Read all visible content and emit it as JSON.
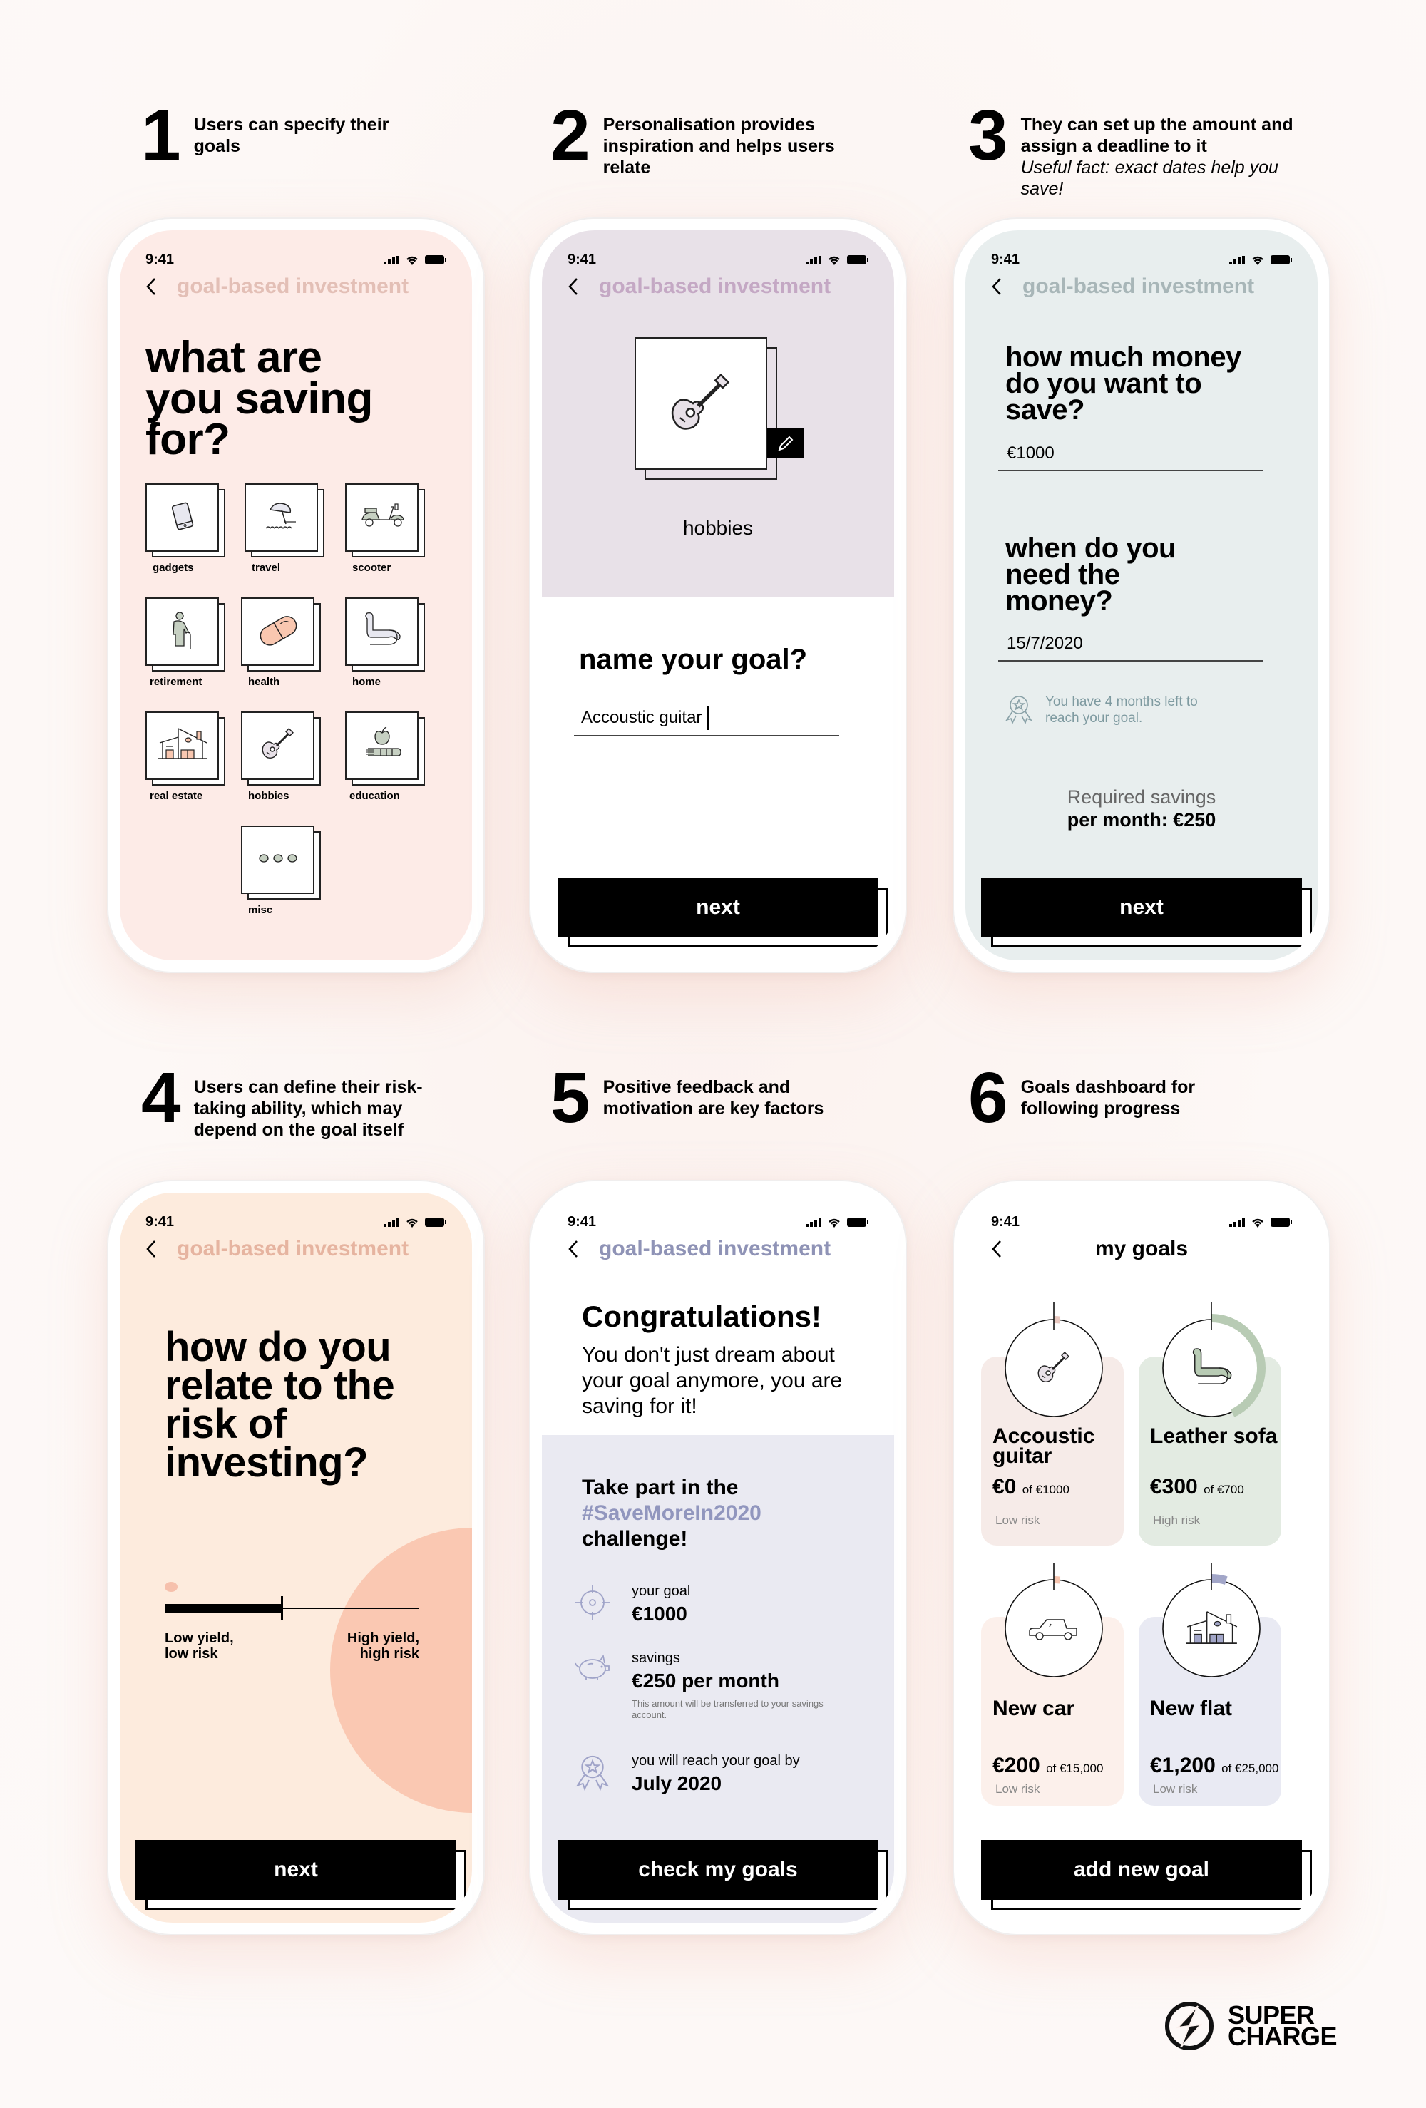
{
  "steps": [
    {
      "num": "1",
      "text": "Users can specify their goals"
    },
    {
      "num": "2",
      "text": "Personalisation provides inspiration and helps users relate"
    },
    {
      "num": "3",
      "text": "They can set up the amount and assign a deadline to it",
      "note": "Useful fact: exact dates help you save!"
    },
    {
      "num": "4",
      "text": "Users can define their risk-taking ability, which may depend on the goal itself"
    },
    {
      "num": "5",
      "text": "Positive feedback and motivation are key factors"
    },
    {
      "num": "6",
      "text": "Goals dashboard for following progress"
    }
  ],
  "status_time": "9:41",
  "nav_title": "goal-based investment",
  "screen1": {
    "question": "what are you saving for?",
    "categories": [
      {
        "label": "gadgets",
        "icon": "tablet-icon"
      },
      {
        "label": "travel",
        "icon": "beach-umbrella-icon"
      },
      {
        "label": "scooter",
        "icon": "scooter-icon"
      },
      {
        "label": "retirement",
        "icon": "elderly-person-icon"
      },
      {
        "label": "health",
        "icon": "pill-icon"
      },
      {
        "label": "home",
        "icon": "rocking-chair-icon"
      },
      {
        "label": "real estate",
        "icon": "house-icon"
      },
      {
        "label": "hobbies",
        "icon": "guitar-icon"
      },
      {
        "label": "education",
        "icon": "apple-book-icon"
      },
      {
        "label": "misc",
        "icon": "more-dots-icon"
      }
    ]
  },
  "screen2": {
    "category_label": "hobbies",
    "question": "name your goal?",
    "goal_name_value": "Accoustic guitar",
    "next_label": "next"
  },
  "screen3": {
    "q_amount": "how much money do you want to save?",
    "amount_value": "€1000",
    "q_date": "when do you need the money?",
    "date_value": "15/7/2020",
    "hint": "You have 4 months left to reach your goal.",
    "required_label": "Required savings",
    "required_value": "per month: €250",
    "next_label": "next"
  },
  "screen4": {
    "question": "how do you relate to the risk of investing?",
    "risk_level": 0.46,
    "low_label": "Low yield, low risk",
    "high_label": "High yield, high risk",
    "next_label": "next"
  },
  "screen5": {
    "title": "Congratulations!",
    "message": "You don't just dream about your goal anymore, you are saving for it!",
    "challenge_pre": "Take part in the",
    "challenge_tag": "#SaveMoreIn2020",
    "challenge_post": "challenge!",
    "goal_label": "your goal",
    "goal_value": "€1000",
    "savings_label": "savings",
    "savings_value": "€250 per month",
    "savings_note": "This amount will be transferred to your savings account.",
    "reach_label": "you will reach your goal by",
    "reach_value": "July 2020",
    "button_label": "check my goals"
  },
  "screen6": {
    "title": "my goals",
    "goals": [
      {
        "name": "Accoustic guitar",
        "saved": "€0",
        "of": "of €1000",
        "risk": "Low risk",
        "progress": 0.0,
        "color": "#e8c8c0",
        "bg": "#f6ebe8"
      },
      {
        "name": "Leather sofa",
        "saved": "€300",
        "of": "of €700",
        "risk": "High risk",
        "progress": 0.43,
        "color": "#b8cbb4",
        "bg": "#e3ebe2"
      },
      {
        "name": "New car",
        "saved": "€200",
        "of": "of €15,000",
        "risk": "Low risk",
        "progress": 0.013,
        "color": "#f6c5b0",
        "bg": "#fcf0eb"
      },
      {
        "name": "New flat",
        "saved": "€1,200",
        "of": "of €25,000",
        "risk": "Low risk",
        "progress": 0.048,
        "color": "#a2a6c8",
        "bg": "#e9eaf3"
      }
    ],
    "button_label": "add new goal"
  },
  "brand": {
    "line1": "SUPER",
    "line2": "CHARGE"
  },
  "colors": {
    "pink_bg": "#fdebe7",
    "lilac_bg": "#e8e1e8",
    "mint_bg": "#e8eeee",
    "peach_bg": "#fdebdd",
    "lavender_bg": "#eaeaf2"
  }
}
